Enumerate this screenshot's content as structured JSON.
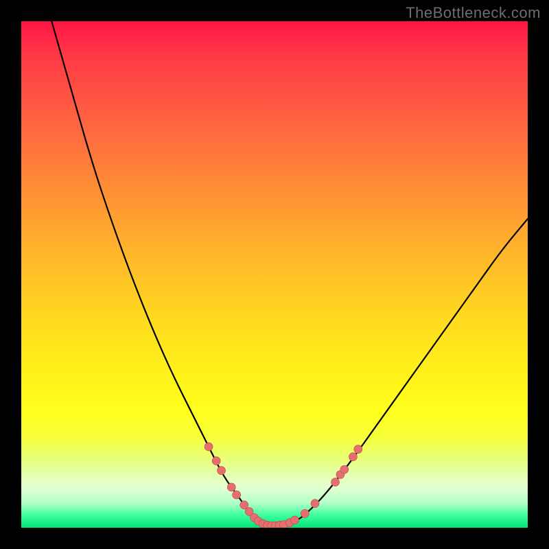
{
  "watermark": "TheBottleneck.com",
  "colors": {
    "page_background": "#000000",
    "curve_stroke": "#000000",
    "marker_fill": "#e36f6f",
    "marker_stroke": "#b94848",
    "gradient_stops": [
      "#ff1646",
      "#ff3a46",
      "#ff5144",
      "#ff6a3f",
      "#ff8438",
      "#ff9d31",
      "#ffb62a",
      "#ffcd23",
      "#ffe21d",
      "#fff21a",
      "#ffff1c",
      "#f7ff3a",
      "#e9ff72",
      "#e4ffa6",
      "#e4ffd3",
      "#b8ffc8",
      "#3dffa0",
      "#00e47a"
    ]
  },
  "chart_data": {
    "type": "line",
    "title": "",
    "xlabel": "",
    "ylabel": "",
    "xlim": [
      0,
      100
    ],
    "ylim": [
      0,
      100
    ],
    "grid": false,
    "legend": false,
    "note": "V-shaped bottleneck curve on rainbow heatmap background; y is read as 0=bottom to 100=top of plot area; x as 0=left to 100=right. Values estimated from pixels.",
    "series": [
      {
        "name": "bottleneck-curve",
        "x": [
          6,
          10,
          14,
          18,
          22,
          26,
          30,
          34,
          37,
          40,
          43,
          45,
          47,
          48.5,
          50,
          52,
          54,
          56,
          60,
          65,
          70,
          75,
          80,
          85,
          90,
          95,
          100
        ],
        "values": [
          100,
          86,
          72,
          60,
          49,
          39,
          30,
          22,
          16,
          10,
          6,
          3,
          1.2,
          0.5,
          0.4,
          0.6,
          1.2,
          2.5,
          6.5,
          13,
          20,
          27,
          34,
          41,
          48,
          55,
          61
        ]
      }
    ],
    "markers": [
      {
        "x": 37.0,
        "y": 16.0
      },
      {
        "x": 38.5,
        "y": 13.2
      },
      {
        "x": 39.5,
        "y": 11.3
      },
      {
        "x": 41.5,
        "y": 8.0
      },
      {
        "x": 42.5,
        "y": 6.5
      },
      {
        "x": 44.0,
        "y": 4.5
      },
      {
        "x": 45.0,
        "y": 3.2
      },
      {
        "x": 46.0,
        "y": 2.0
      },
      {
        "x": 46.8,
        "y": 1.3
      },
      {
        "x": 47.7,
        "y": 0.8
      },
      {
        "x": 48.6,
        "y": 0.5
      },
      {
        "x": 49.4,
        "y": 0.4
      },
      {
        "x": 50.2,
        "y": 0.4
      },
      {
        "x": 51.0,
        "y": 0.5
      },
      {
        "x": 51.8,
        "y": 0.6
      },
      {
        "x": 53.0,
        "y": 1.0
      },
      {
        "x": 54.0,
        "y": 1.5
      },
      {
        "x": 56.0,
        "y": 2.8
      },
      {
        "x": 58.0,
        "y": 4.8
      },
      {
        "x": 62.0,
        "y": 9.0
      },
      {
        "x": 63.0,
        "y": 10.5
      },
      {
        "x": 63.8,
        "y": 11.5
      },
      {
        "x": 65.5,
        "y": 14.0
      },
      {
        "x": 66.5,
        "y": 15.5
      }
    ]
  }
}
